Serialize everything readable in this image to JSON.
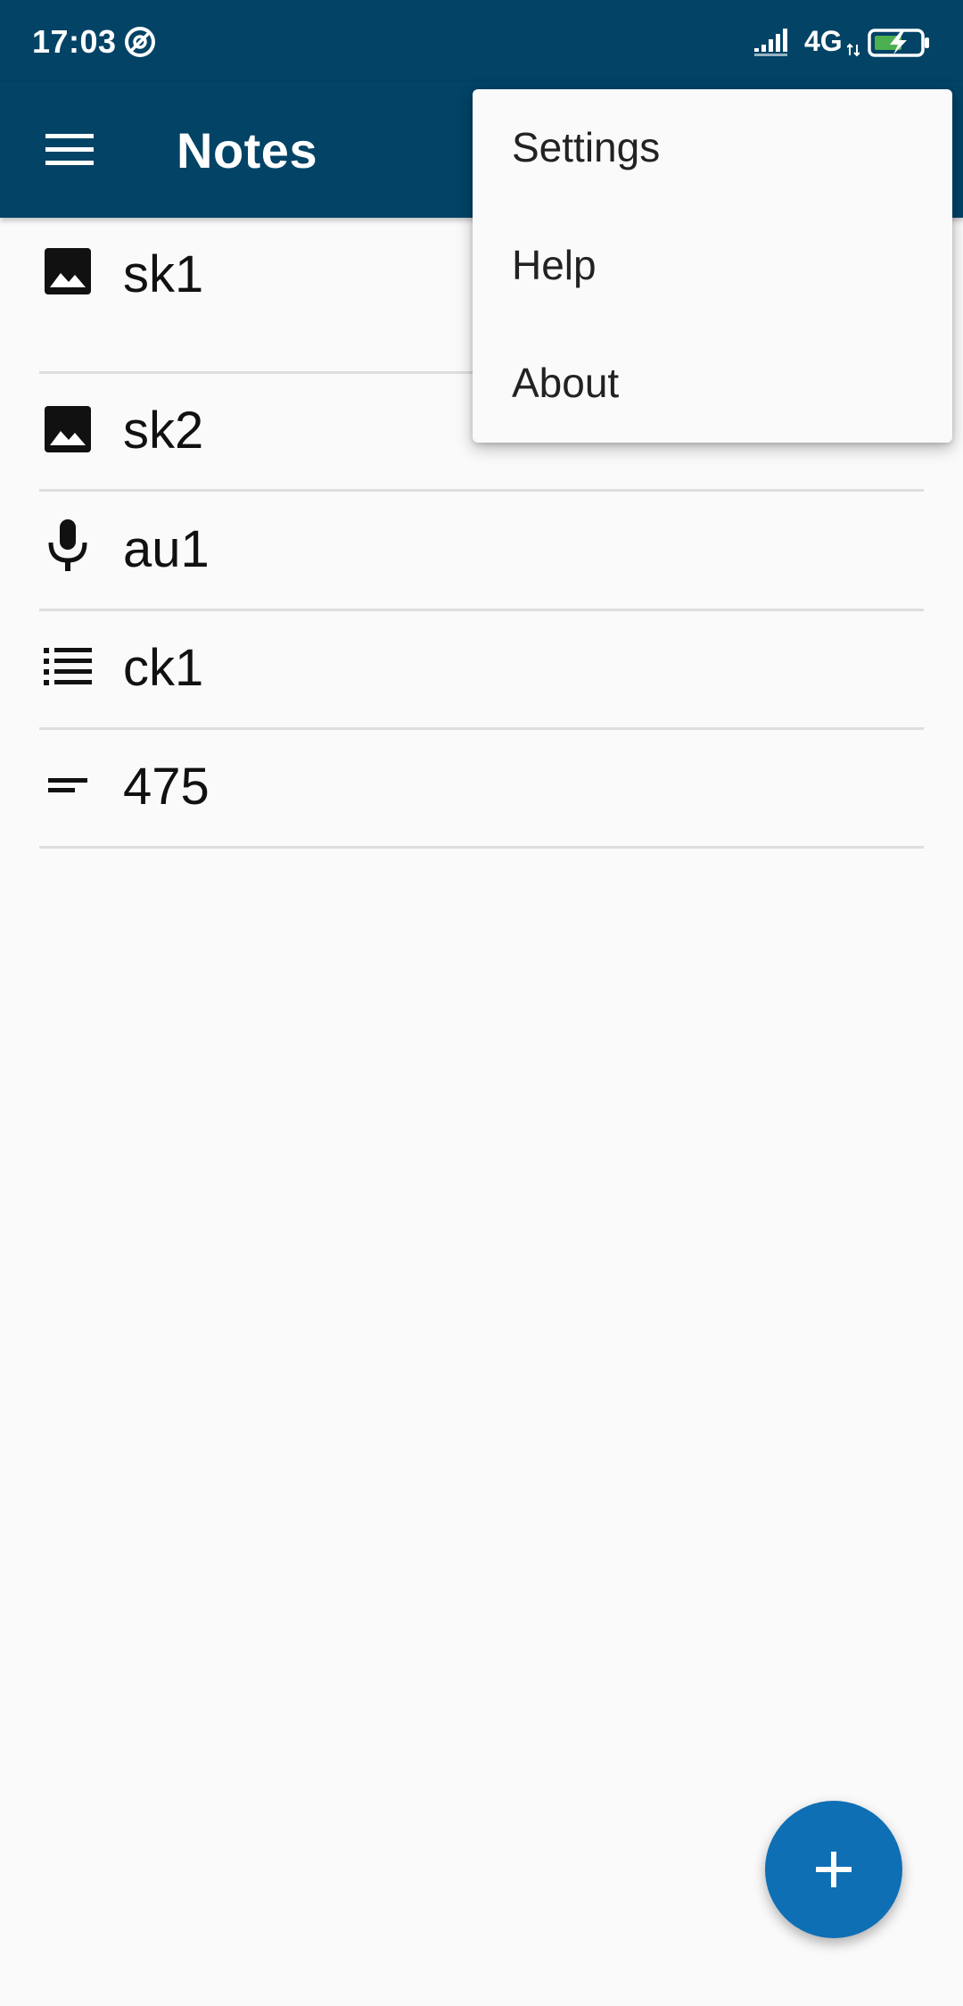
{
  "status_bar": {
    "time": "17:03",
    "network": "4G",
    "icons": [
      "do-not-disturb-icon",
      "signal-icon",
      "battery-charging-icon"
    ]
  },
  "app_bar": {
    "title": "Notes",
    "menu_icon": "hamburger-menu-icon",
    "background_color": "#024366"
  },
  "notes": [
    {
      "title": "sk1",
      "icon": "image-icon"
    },
    {
      "title": "sk2",
      "icon": "image-icon"
    },
    {
      "title": "au1",
      "icon": "microphone-icon"
    },
    {
      "title": "ck1",
      "icon": "checklist-icon"
    },
    {
      "title": "475",
      "icon": "text-note-icon"
    }
  ],
  "overflow_menu": {
    "items": [
      {
        "label": "Settings"
      },
      {
        "label": "Help"
      },
      {
        "label": "About"
      }
    ]
  },
  "fab": {
    "icon": "plus-icon",
    "color": "#0e6fb5"
  }
}
